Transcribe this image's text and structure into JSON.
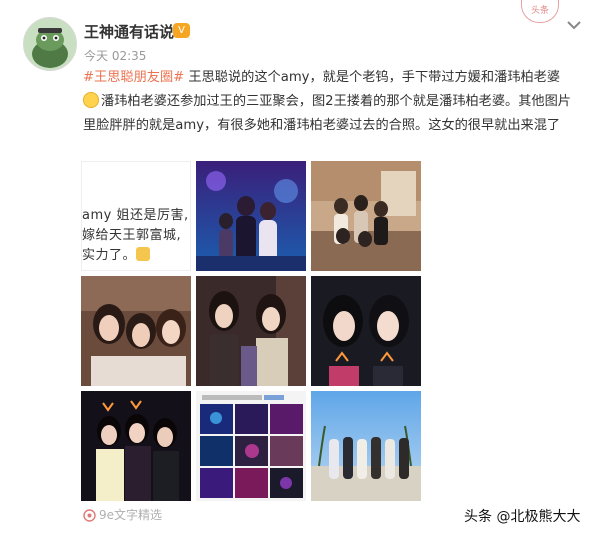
{
  "post": {
    "username": "王神通有话说",
    "vip_badge": "V",
    "timestamp": "今天 02:35",
    "stamp_text": "头条",
    "text": {
      "hashtag": "#王思聪朋友圈#",
      "body_1": " 王思聪说的这个amy，就是个老钨，手下带过方媛和潘玮柏老婆",
      "body_2": "潘玮柏老婆还参加过王的三亚聚会，图2王搂着的那个就是潘玮柏老婆。其他图片里脸胖胖的就是amy，有很多她和潘玮柏老婆过去的合照。这女的很早就出来混了"
    },
    "image_text": {
      "line_1": "amy 姐还是厉害,",
      "line_2": "嫁给天王郭富城,",
      "line_3": "实力了。"
    },
    "thumbnail_caption": "王思聪朋友圈",
    "footer_source": "9e文字精选",
    "watermark": "头条 @北极熊大大"
  },
  "colors": {
    "hashtag": "#eb7350",
    "timestamp": "#999999",
    "footer": "#b0b0b0"
  },
  "icons": [
    "avatar",
    "vip-badge-icon",
    "chevron-down-icon",
    "smiley-emoji-icon",
    "thumbs-up-emoji-icon",
    "repost-source-icon"
  ]
}
